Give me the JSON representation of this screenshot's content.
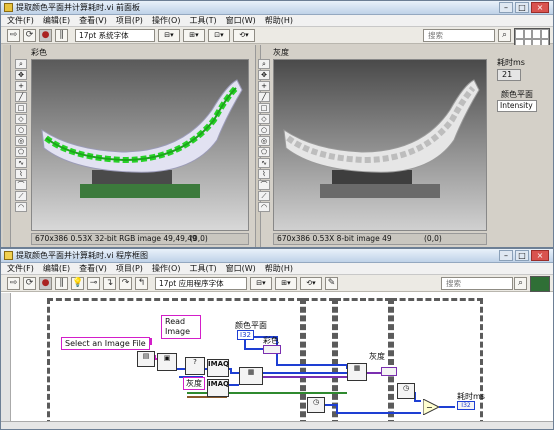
{
  "front_panel": {
    "title": "提取颜色平面并计算耗时.vi 前面板",
    "menu": [
      "文件(F)",
      "编辑(E)",
      "查看(V)",
      "项目(P)",
      "操作(O)",
      "工具(T)",
      "窗口(W)",
      "帮助(H)"
    ],
    "font_selector": "17pt 系统字体",
    "search_placeholder": "搜索",
    "color_label": "彩色",
    "gray_label": "灰度",
    "color_status": "670x386 0.53X 32-bit RGB image 49,49,49",
    "color_coord": "(0,0)",
    "gray_status": "670x386 0.53X 8-bit image 49",
    "gray_coord": "(0,0)",
    "time_label": "耗时ms",
    "time_value": "21",
    "plane_label": "颜色平面",
    "plane_value": "Intensity"
  },
  "block_diagram": {
    "title": "提取颜色平面并计算耗时.vi 程序框图",
    "menu": [
      "文件(F)",
      "编辑(E)",
      "查看(V)",
      "项目(P)",
      "操作(O)",
      "工具(T)",
      "窗口(W)",
      "帮助(H)"
    ],
    "font_selector": "17pt 应用程序字体",
    "search_placeholder": "搜索",
    "read_image": "Read\nImage",
    "select_file": "Select an Image File",
    "color_plane_label": "颜色平面",
    "color_plane_const": "I32",
    "color_term": "彩色",
    "gray_term": "灰度",
    "gray_out_label": "灰度",
    "time_label": "耗时ms",
    "imaq1": "IMAQ",
    "imaq2": "IMAQ"
  },
  "colors": {
    "window_bg": "#d4d0c8",
    "diagram_bg": "#ffffff",
    "pink_wire": "#d31ec9",
    "blue_wire": "#1e3fd3",
    "green_wire": "#2f8a2f",
    "brown_wire": "#8a5a2b"
  }
}
